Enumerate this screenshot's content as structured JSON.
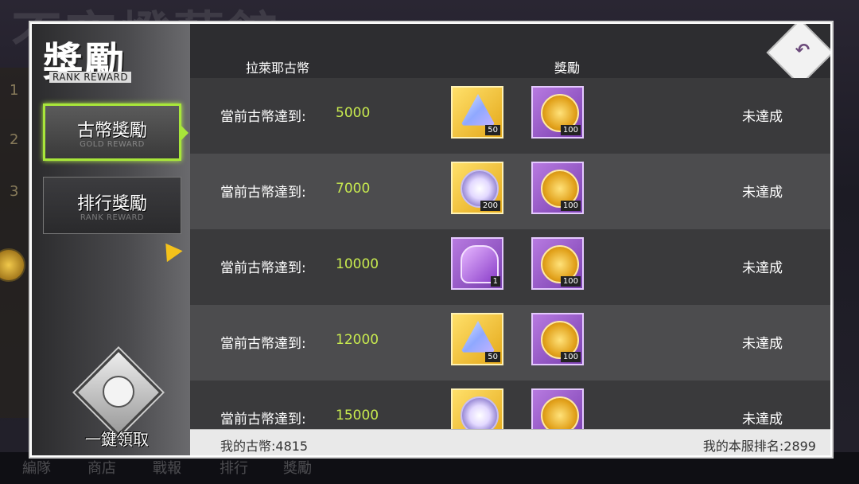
{
  "background": {
    "title": "不夜燈藝館",
    "rank_markers": [
      "1",
      "2",
      "3"
    ],
    "bottom_tabs": [
      "編隊",
      "商店",
      "戰報",
      "排行",
      "獎勵"
    ]
  },
  "sidebar": {
    "title": "獎勵",
    "subtitle": "RANK REWARD",
    "nav": [
      {
        "label": "古幣獎勵",
        "sub": "GOLD REWARD",
        "active": true
      },
      {
        "label": "排行獎勵",
        "sub": "RANK REWARD",
        "active": false
      }
    ],
    "claim_all_label": "一鍵領取"
  },
  "header": {
    "col_currency": "拉萊耶古幣",
    "col_reward": "獎勵"
  },
  "rows": [
    {
      "label": "當前古幣達到:",
      "value": "5000",
      "items": [
        {
          "icon": "powder-icon",
          "count": "50"
        },
        {
          "icon": "gold-medal-icon",
          "count": "100"
        }
      ],
      "status": "未達成"
    },
    {
      "label": "當前古幣達到:",
      "value": "7000",
      "items": [
        {
          "icon": "silver-medal-icon",
          "count": "200"
        },
        {
          "icon": "gold-medal-icon",
          "count": "100"
        }
      ],
      "status": "未達成"
    },
    {
      "label": "當前古幣達到:",
      "value": "10000",
      "items": [
        {
          "icon": "gift-box-icon",
          "count": "1"
        },
        {
          "icon": "gold-medal-icon",
          "count": "100"
        }
      ],
      "status": "未達成"
    },
    {
      "label": "當前古幣達到:",
      "value": "12000",
      "items": [
        {
          "icon": "powder-icon",
          "count": "50"
        },
        {
          "icon": "gold-medal-icon",
          "count": "100"
        }
      ],
      "status": "未達成"
    },
    {
      "label": "當前古幣達到:",
      "value": "15000",
      "items": [
        {
          "icon": "silver-medal-icon",
          "count": ""
        },
        {
          "icon": "gold-medal-icon",
          "count": ""
        }
      ],
      "status": "未達成"
    }
  ],
  "footer": {
    "my_coins": "我的古幣:4815",
    "my_rank": "我的本服排名:2899"
  },
  "colors": {
    "accent_green": "#a8e63a",
    "value_green": "#c8ea4f",
    "item_gold": "#e4a81a",
    "item_purple": "#7a3fb0"
  }
}
